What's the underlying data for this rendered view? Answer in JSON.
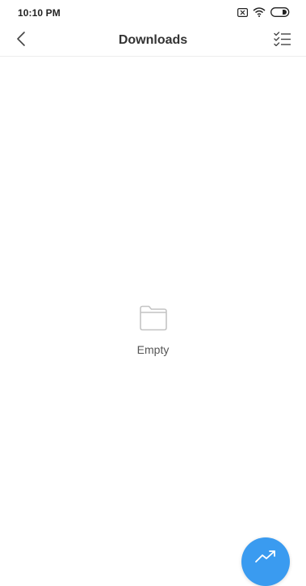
{
  "status_bar": {
    "time": "10:10 PM",
    "icons": [
      "sim-error-icon",
      "wifi-icon",
      "battery-icon"
    ]
  },
  "header": {
    "title": "Downloads",
    "back_icon": "chevron-left-icon",
    "select_icon": "checklist-icon"
  },
  "empty_state": {
    "icon": "folder-icon",
    "label": "Empty"
  },
  "fab": {
    "icon": "trend-icon",
    "color": "#3a9bf0"
  }
}
